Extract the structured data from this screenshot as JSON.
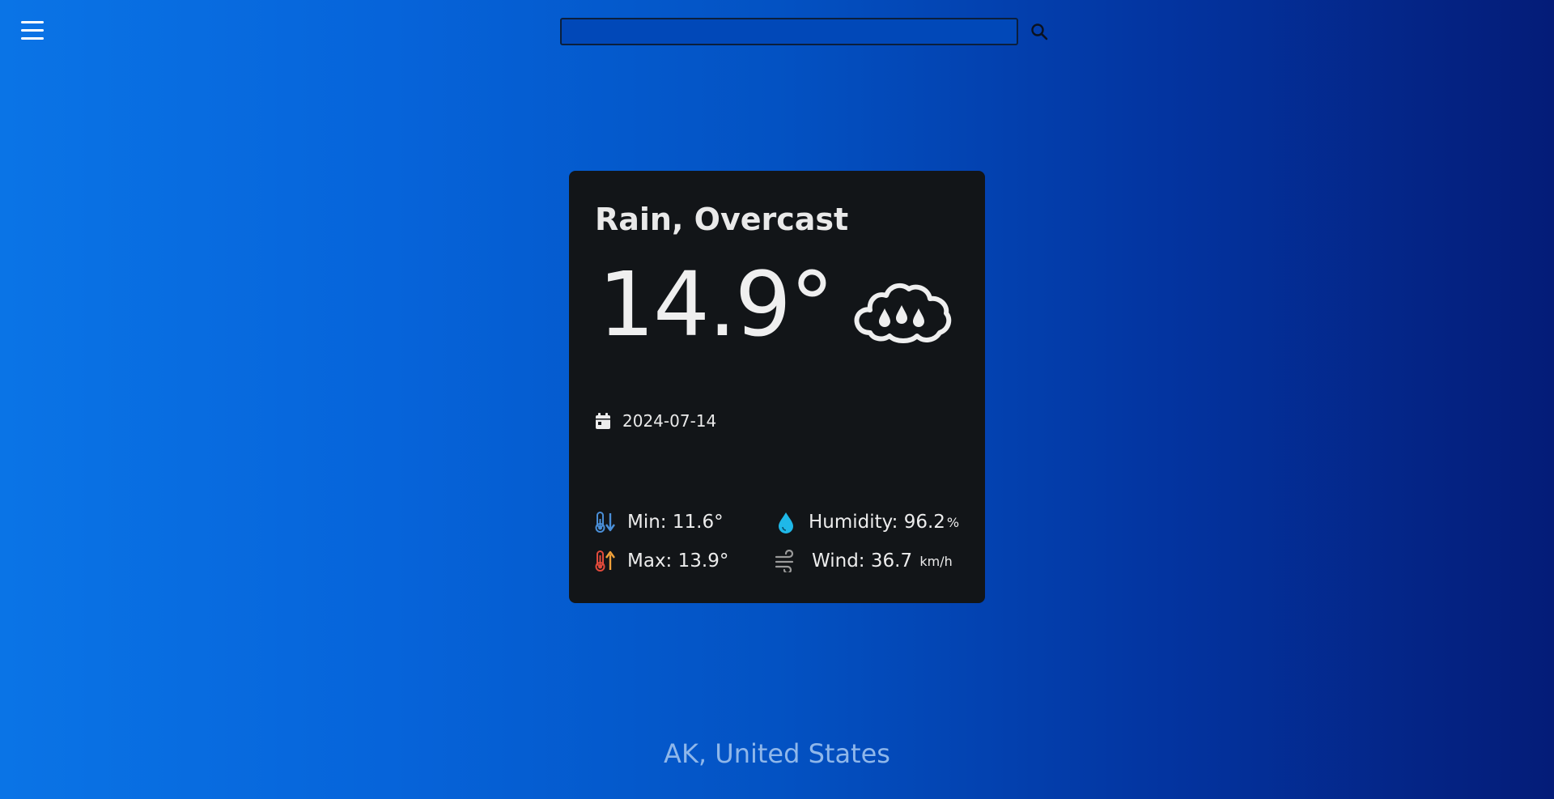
{
  "header": {
    "menu_icon": "hamburger-menu-icon",
    "search": {
      "value": "",
      "placeholder": "",
      "button_icon": "search-icon"
    }
  },
  "weather": {
    "condition": "Rain, Overcast",
    "temperature": "14.9°",
    "condition_icon": "rain-cloud-icon",
    "date": "2024-07-14",
    "date_icon": "calendar-icon",
    "min": {
      "label": "Min:",
      "value": "11.6°",
      "icon": "thermometer-down-icon",
      "color": "#4a8fd8"
    },
    "max": {
      "label": "Max:",
      "value": "13.9°",
      "icon": "thermometer-up-icon",
      "color": "#f0a13a"
    },
    "humidity": {
      "label": "Humidity:",
      "value": "96.2",
      "unit": "%",
      "icon": "water-drop-icon",
      "color": "#1fb8e8"
    },
    "wind": {
      "label": "Wind:",
      "value": "36.7",
      "unit": "km/h",
      "icon": "wind-icon",
      "color": "#9a9a9a"
    }
  },
  "location": "AK, United States",
  "colors": {
    "background_start": "#0a74e6",
    "background_end": "#041c78",
    "card_background": "#121518"
  }
}
